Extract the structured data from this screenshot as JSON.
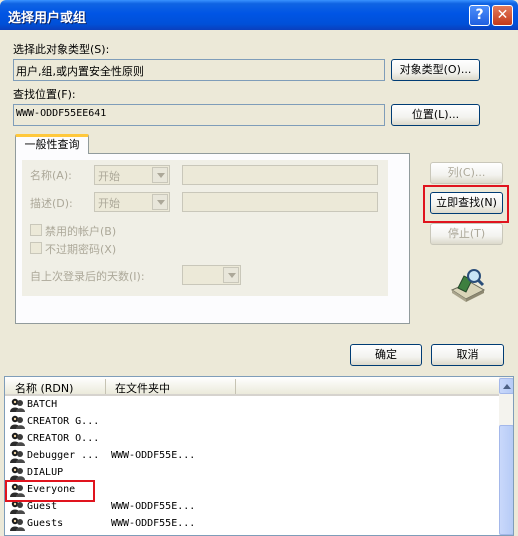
{
  "window": {
    "title": "选择用户或组"
  },
  "object_type": {
    "label": "选择此对象类型(S):",
    "value": "用户,组,或内置安全性原则",
    "button": "对象类型(O)..."
  },
  "location": {
    "label": "查找位置(F):",
    "value": "WWW-ODDF55EE641",
    "button": "位置(L)..."
  },
  "query": {
    "tab": "一般性查询",
    "name_label": "名称(A):",
    "name_mode": "开始",
    "desc_label": "描述(D):",
    "desc_mode": "开始",
    "disabled_accounts": "禁用的帐户(B)",
    "non_expiring": "不过期密码(X)",
    "days_label": "自上次登录后的天数(I):"
  },
  "side_buttons": {
    "columns": "列(C)...",
    "find_now": "立即查找(N)",
    "stop": "停止(T)"
  },
  "dialog_buttons": {
    "ok": "确定",
    "cancel": "取消"
  },
  "results": {
    "headers": [
      "名称 (RDN)",
      "在文件夹中"
    ],
    "rows": [
      {
        "name": "BATCH",
        "folder": ""
      },
      {
        "name": "CREATOR G...",
        "folder": ""
      },
      {
        "name": "CREATOR O...",
        "folder": ""
      },
      {
        "name": "Debugger ...",
        "folder": "WWW-ODDF55E..."
      },
      {
        "name": "DIALUP",
        "folder": ""
      },
      {
        "name": "Everyone",
        "folder": ""
      },
      {
        "name": "Guest",
        "folder": "WWW-ODDF55E..."
      },
      {
        "name": "Guests",
        "folder": "WWW-ODDF55E..."
      }
    ]
  },
  "colors": {
    "title_bar": "#0055e5",
    "highlight": "#e0141e",
    "dialog_bg": "#ece9d8"
  }
}
